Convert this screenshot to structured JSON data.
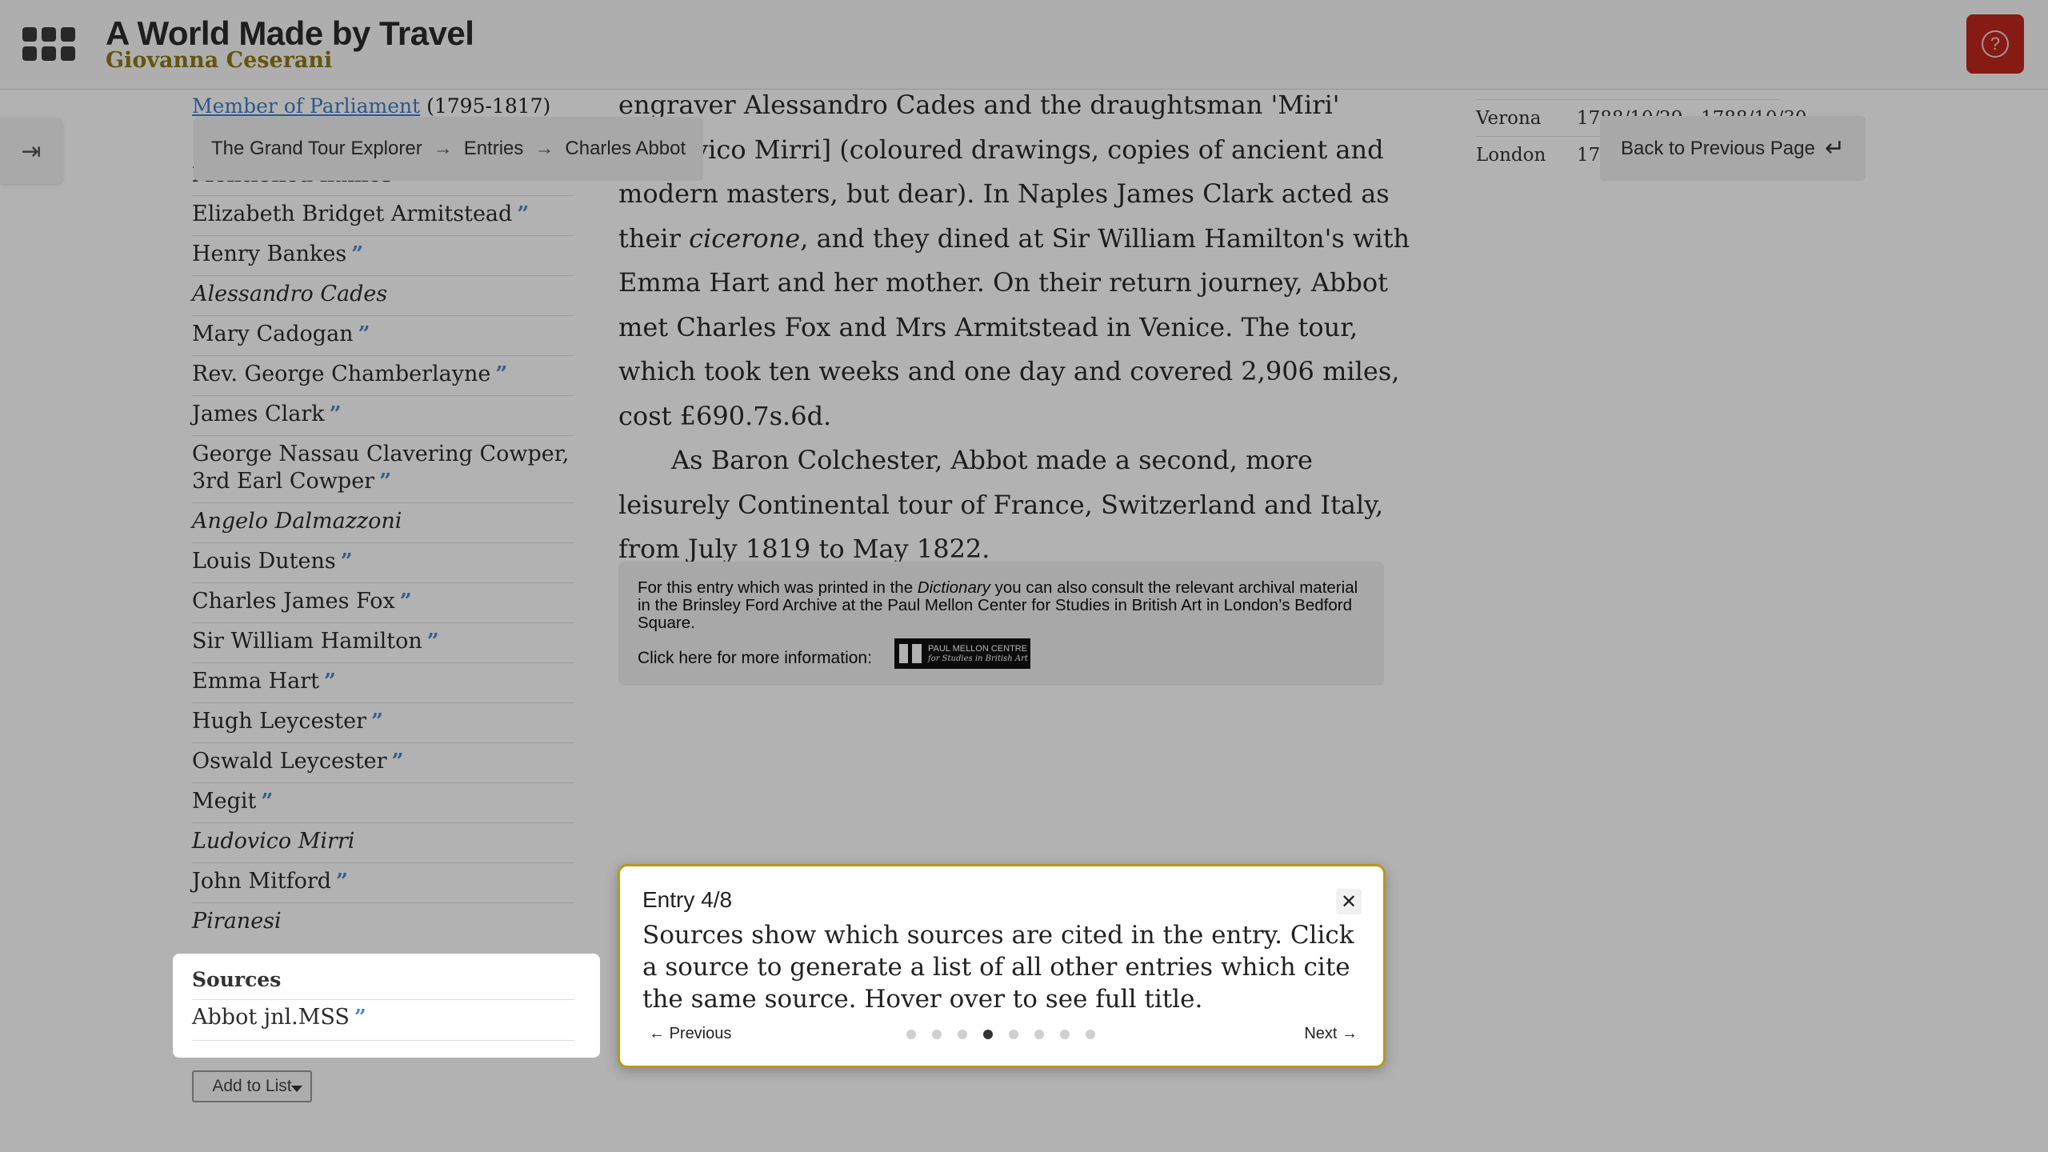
{
  "header": {
    "title": "A World Made by Travel",
    "author": "Giovanna Ceserani",
    "help_icon": "question-mark-icon"
  },
  "breadcrumb": [
    "The Grand Tour Explorer",
    "Entries",
    "Charles Abbot"
  ],
  "back_button": "Back to Previous Page",
  "left": {
    "mp_link": "Member of Parliament",
    "mp_years": "(1795-1817)",
    "mentioned_header": "Mentioned names",
    "names": [
      {
        "name": "Elizabeth Bridget Armitstead",
        "quote": true,
        "italic": false
      },
      {
        "name": "Henry Bankes",
        "quote": true,
        "italic": false
      },
      {
        "name": "Alessandro Cades",
        "quote": false,
        "italic": true
      },
      {
        "name": "Mary Cadogan",
        "quote": true,
        "italic": false
      },
      {
        "name": "Rev. George Chamberlayne",
        "quote": true,
        "italic": false
      },
      {
        "name": "James Clark",
        "quote": true,
        "italic": false
      },
      {
        "name": "George Nassau Clavering Cowper, 3rd Earl Cowper",
        "quote": true,
        "italic": false
      },
      {
        "name": "Angelo Dalmazzoni",
        "quote": false,
        "italic": true
      },
      {
        "name": "Louis Dutens",
        "quote": true,
        "italic": false
      },
      {
        "name": "Charles James Fox",
        "quote": true,
        "italic": false
      },
      {
        "name": "Sir William Hamilton",
        "quote": true,
        "italic": false
      },
      {
        "name": "Emma Hart",
        "quote": true,
        "italic": false
      },
      {
        "name": "Hugh Leycester",
        "quote": true,
        "italic": false
      },
      {
        "name": "Oswald Leycester",
        "quote": true,
        "italic": false
      },
      {
        "name": "Megit",
        "quote": true,
        "italic": false
      },
      {
        "name": "Ludovico Mirri",
        "quote": false,
        "italic": true
      },
      {
        "name": "John Mitford",
        "quote": true,
        "italic": false
      },
      {
        "name": "Piranesi",
        "quote": false,
        "italic": true
      }
    ],
    "quote_mark": "”",
    "sources_title": "Sources",
    "source_item": "Abbot jnl.MSS",
    "add_to_list": "Add to List"
  },
  "main": {
    "para1_before_italic": "engraver Alessandro Cades and the draughtsman 'Miri' [Ludovico Mirri] (coloured drawings, copies of ancient and modern masters, but dear). In Naples James Clark acted as their ",
    "para1_italic": "cicerone",
    "para1_after_italic": ", and they dined at Sir William Hamilton's with Emma Hart and her mother. On their return journey, Abbot met Charles Fox and Mrs Armitstead in Venice. The tour, which took ten weeks and one day and covered 2,906 miles, cost £690.7s.6d.",
    "para2": "As Baron Colchester, Abbot made a second, more leisurely Continental tour of France, Switzerland and Italy, from July 1819 to May 1822."
  },
  "archive": {
    "text_before": "For this entry which was printed in the ",
    "text_italic": "Dictionary",
    "text_after": " you can also consult the relevant archival material in the Brinsley Ford Archive at the Paul Mellon Center for Studies in British Art in London’s Bedford Square.",
    "click_label": "Click here for more information:",
    "logo_line1": "PAUL MELLON CENTRE",
    "logo_line2": "for Studies in British Art"
  },
  "places": [
    {
      "place": "Verona",
      "dates": "1788/10/29 - 1788/10/30"
    },
    {
      "place": "London",
      "dates": "1788/11/06"
    }
  ],
  "tour": {
    "title": "Entry 4/8",
    "body": "Sources show which sources are cited in the entry. Click a source to generate a list of all other entries which cite the same source. Hover over to see full title.",
    "prev": "Previous",
    "next": "Next",
    "total_steps": 8,
    "current_step": 4
  }
}
